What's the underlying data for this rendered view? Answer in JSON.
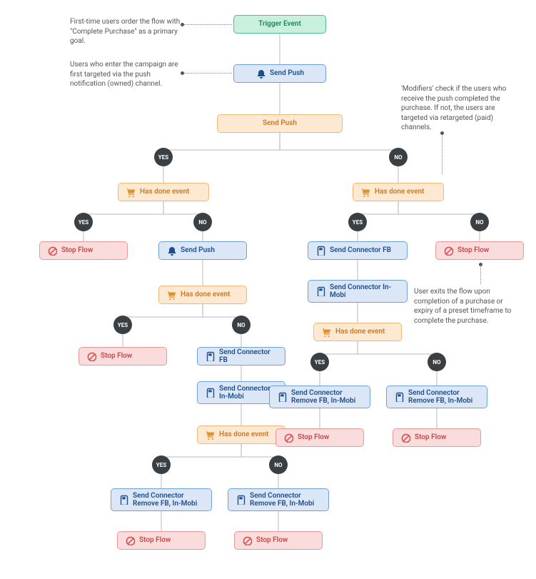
{
  "trigger": "Trigger Event",
  "sendPush": "Send Push",
  "hasDone": "Has done event",
  "stopFlow": "Stop Flow",
  "sendFB": "Send Connector FB",
  "sendInMobi": "Send Connector In-Mobi",
  "removeFBInMobi": "Send Connector Remove FB, In-Mobi",
  "yes": "YES",
  "no": "NO",
  "anno1": "First-time users order the flow with \"Complete Purchase\" as a primary goal.",
  "anno2": "Users who enter the campaign are first targeted via the push notification (owned) channel.",
  "anno3": "'Modifiers' check if the users who receive the push completed the purchase. If not, the users are targeted via retargeted (paid) channels.",
  "anno4": "User exits the flow upon completion of a purchase or expiry of a preset timeframe to complete the purchase."
}
